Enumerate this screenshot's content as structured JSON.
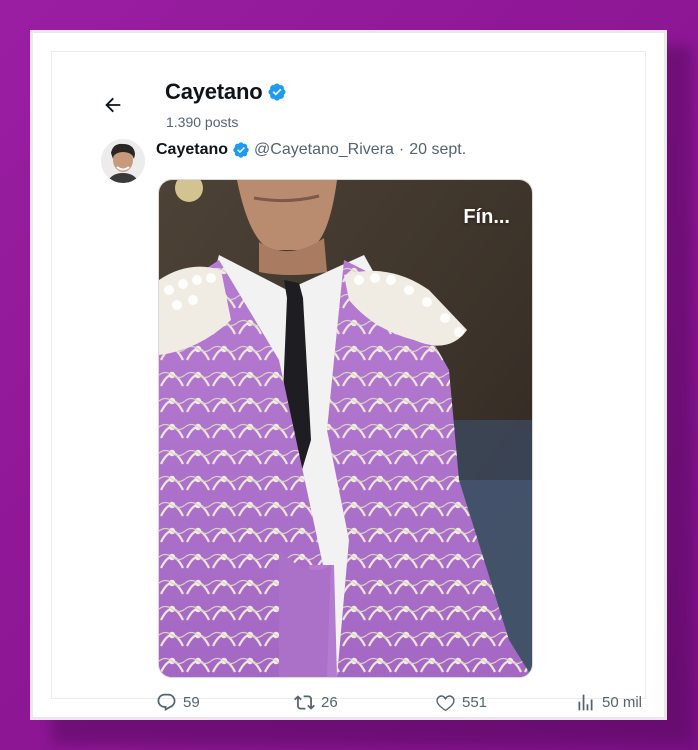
{
  "header": {
    "title": "Cayetano",
    "posts_count": "1.390 posts"
  },
  "tweet": {
    "author_name": "Cayetano",
    "handle": "@Cayetano_Rivera",
    "separator": "·",
    "date": "20 sept.",
    "image_overlay_text": "Fín..."
  },
  "actions": {
    "replies": "59",
    "retweets": "26",
    "likes": "551",
    "views": "50 mil"
  },
  "colors": {
    "background_frame": "#8d1a94",
    "verified_blue": "#1d9bf0",
    "secondary_text": "#536471",
    "primary_text": "#0f1419"
  },
  "icons": {
    "back": "arrow-left-icon",
    "verified": "verified-badge-icon",
    "reply": "comment-icon",
    "retweet": "retweet-icon",
    "like": "heart-icon",
    "views": "bar-chart-icon"
  }
}
